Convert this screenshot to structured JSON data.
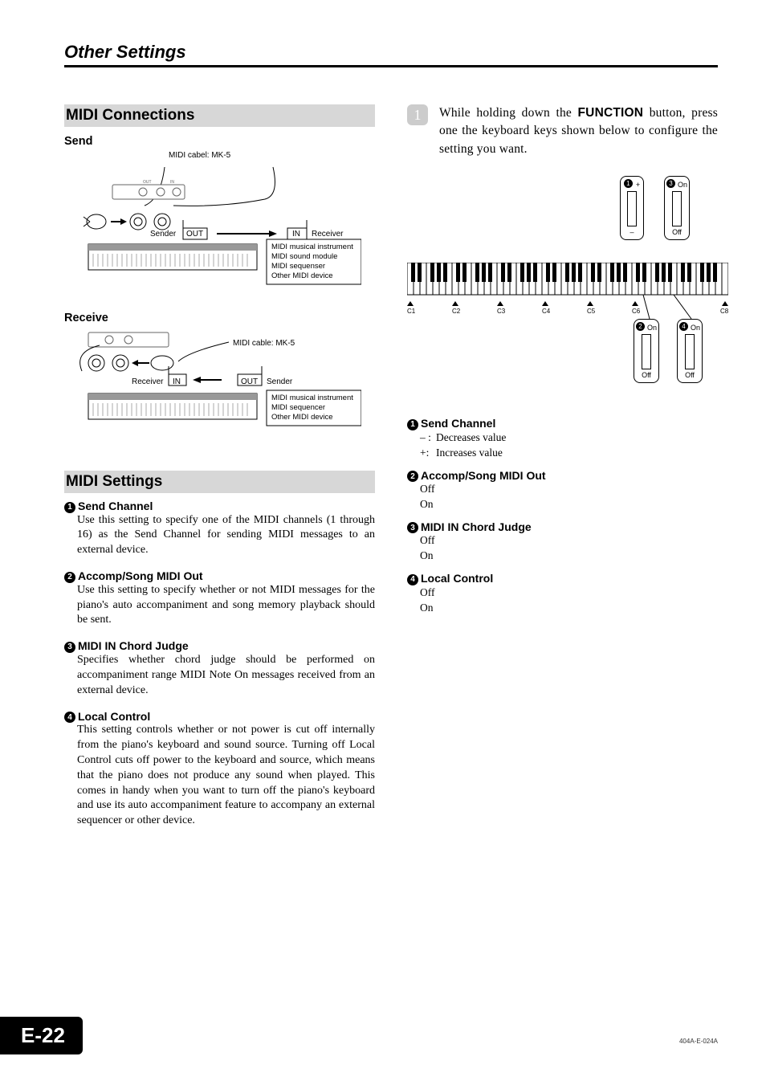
{
  "breadcrumb": "Other Settings",
  "left": {
    "section1_title": "MIDI Connections",
    "send_head": "Send",
    "send_fig": {
      "cable": "MIDI cabel: MK-5",
      "sender": "Sender",
      "out": "OUT",
      "in": "IN",
      "receiver": "Receiver",
      "list": [
        "MIDI musical instrument",
        "MIDI sound module",
        "MIDI sequenser",
        "Other MIDI device"
      ]
    },
    "receive_head": "Receive",
    "recv_fig": {
      "cable": "MIDI cable: MK-5",
      "receiver": "Receiver",
      "in": "IN",
      "out": "OUT",
      "sender": "Sender",
      "list": [
        "MIDI musical instrument",
        "MIDI sequencer",
        "Other MIDI device"
      ]
    },
    "section2_title": "MIDI Settings",
    "settings": [
      {
        "n": "1",
        "title": "Send Channel",
        "body": "Use this setting to specify one of the MIDI channels (1 through 16) as the Send Channel for sending MIDI messages to an external device."
      },
      {
        "n": "2",
        "title": "Accomp/Song MIDI Out",
        "body": "Use this setting to specify whether or not MIDI messages for the piano's auto accompaniment and song memory playback should be sent."
      },
      {
        "n": "3",
        "title": "MIDI IN Chord Judge",
        "body": "Specifies whether chord judge should be performed on accompaniment range MIDI Note On messages received from an external device."
      },
      {
        "n": "4",
        "title": "Local Control",
        "body": "This setting controls whether or not power is cut off internally from the piano's keyboard and sound source. Turning off Local Control cuts off power to the keyboard and source, which means that the piano does not produce any sound when played. This comes in handy when you want to turn off the piano's keyboard and use its auto accompaniment feature to accompany an external sequencer or other device."
      }
    ]
  },
  "right": {
    "step_num": "1",
    "step_text_a": "While holding down the ",
    "step_text_func": "FUNCTION",
    "step_text_b": " button, press one the keyboard keys shown below to configure the setting you want.",
    "callout1_num": "1",
    "callout1_top": "+",
    "callout1_bot": "–",
    "callout3_num": "3",
    "callout3_top": "On",
    "callout3_bot": "Off",
    "callout2_num": "2",
    "callout2_top": "On",
    "callout2_bot": "Off",
    "callout4_num": "4",
    "callout4_top": "On",
    "callout4_bot": "Off",
    "ticks": [
      "C1",
      "C2",
      "C3",
      "C4",
      "C5",
      "C6",
      "C8"
    ],
    "list": [
      {
        "n": "1",
        "title": "Send Channel",
        "rows": [
          [
            "– :",
            "Decreases value"
          ],
          [
            "+:",
            "Increases value"
          ]
        ]
      },
      {
        "n": "2",
        "title": "Accomp/Song MIDI Out",
        "rows": [
          [
            "",
            "Off"
          ],
          [
            "",
            "On"
          ]
        ]
      },
      {
        "n": "3",
        "title": "MIDI IN Chord Judge",
        "rows": [
          [
            "",
            "Off"
          ],
          [
            "",
            "On"
          ]
        ]
      },
      {
        "n": "4",
        "title": "Local Control",
        "rows": [
          [
            "",
            "Off"
          ],
          [
            "",
            "On"
          ]
        ]
      }
    ]
  },
  "page_number": "E-22",
  "doc_code": "404A-E-024A"
}
